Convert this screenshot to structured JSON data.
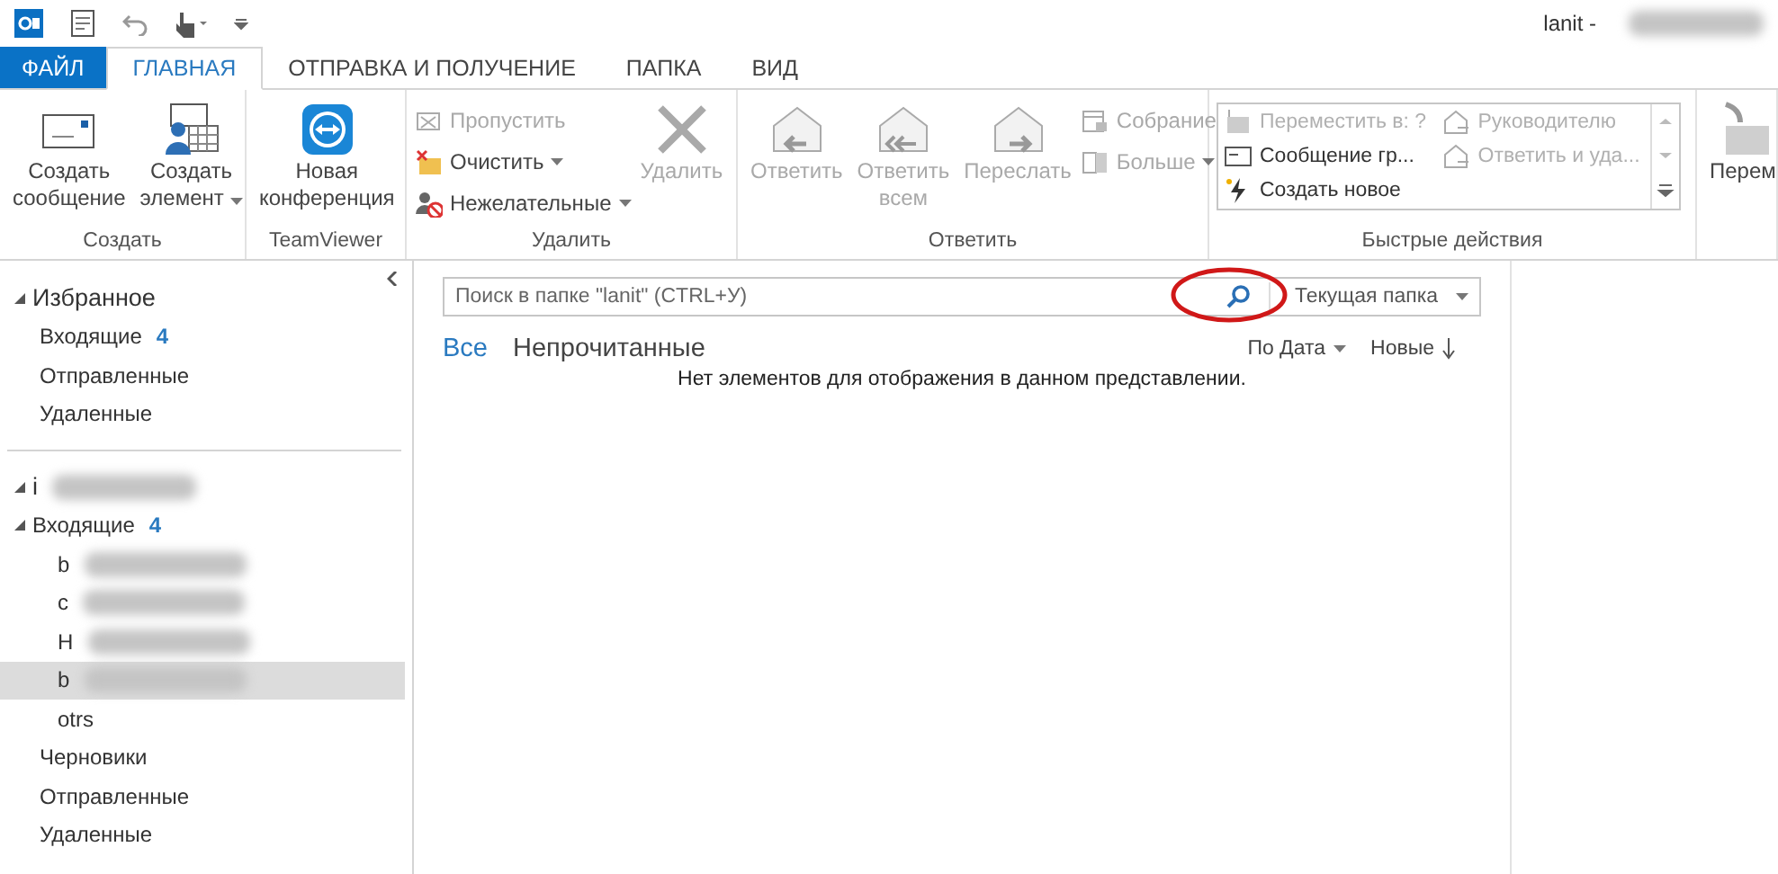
{
  "title_bar": {
    "title": "lanit -",
    "title_redacted": true
  },
  "tabs": [
    {
      "label": "ФАЙЛ",
      "kind": "file",
      "selected": false
    },
    {
      "label": "ГЛАВНАЯ",
      "kind": "tab",
      "selected": true
    },
    {
      "label": "ОТПРАВКА И ПОЛУЧЕНИЕ",
      "kind": "tab",
      "selected": false
    },
    {
      "label": "ПАПКА",
      "kind": "tab",
      "selected": false
    },
    {
      "label": "ВИД",
      "kind": "tab",
      "selected": false
    }
  ],
  "ribbon": {
    "groups": [
      {
        "label": "Создать",
        "items": [
          {
            "kind": "large",
            "label": "Создать\nсообщение",
            "disabled": false,
            "dropdown": false
          },
          {
            "kind": "large",
            "label": "Создать\nэлемент",
            "disabled": false,
            "dropdown": true
          }
        ]
      },
      {
        "label": "TeamViewer",
        "items": [
          {
            "kind": "large",
            "label": "Новая\nконференция",
            "disabled": false,
            "dropdown": false
          }
        ]
      },
      {
        "label": "Удалить",
        "items": [
          {
            "kind": "stack",
            "items": [
              {
                "label": "Пропустить",
                "disabled": true,
                "dropdown": false
              },
              {
                "label": "Очистить",
                "disabled": false,
                "dropdown": true
              },
              {
                "label": "Нежелательные",
                "disabled": false,
                "dropdown": true
              }
            ]
          },
          {
            "kind": "large",
            "label": "Удалить",
            "disabled": true,
            "dropdown": false
          }
        ]
      },
      {
        "label": "Ответить",
        "items": [
          {
            "kind": "large",
            "label": "Ответить",
            "disabled": true,
            "dropdown": false
          },
          {
            "kind": "large",
            "label": "Ответить\nвсем",
            "disabled": true,
            "dropdown": false
          },
          {
            "kind": "large",
            "label": "Переслать",
            "disabled": true,
            "dropdown": false
          },
          {
            "kind": "stack",
            "items": [
              {
                "label": "Собрание",
                "disabled": true,
                "dropdown": false
              },
              {
                "label": "Больше",
                "disabled": true,
                "dropdown": true
              }
            ]
          }
        ]
      },
      {
        "label": "Быстрые действия",
        "items": [
          {
            "kind": "gallery",
            "items": [
              {
                "label": "Переместить в: ?",
                "disabled": true
              },
              {
                "label": "Руководителю",
                "disabled": true
              },
              {
                "label": "Сообщение гр...",
                "disabled": false
              },
              {
                "label": "Ответить и уда...",
                "disabled": true
              },
              {
                "label": "Создать новое",
                "disabled": false
              }
            ]
          }
        ]
      },
      {
        "items": [
          {
            "kind": "large",
            "label": "Перем",
            "disabled": false,
            "dropdown": false
          }
        ]
      }
    ]
  },
  "folder_pane": {
    "favorites": {
      "label": "Избранное",
      "expanded": true,
      "items": [
        {
          "label": "Входящие",
          "count": "4",
          "selected": false
        },
        {
          "label": "Отправленные",
          "selected": false
        },
        {
          "label": "Удаленные",
          "selected": false
        }
      ]
    },
    "account": {
      "label": "i",
      "redacted": true,
      "expanded": true,
      "children": [
        {
          "label": "Входящие",
          "count": "4",
          "expanded": true,
          "selected": false,
          "children": [
            {
              "label": "b",
              "redacted": true,
              "selected": false
            },
            {
              "label": "c",
              "redacted": true,
              "selected": false
            },
            {
              "label": "H",
              "redacted": true,
              "selected": false
            },
            {
              "label": "b",
              "redacted": true,
              "selected": true
            },
            {
              "label": "otrs",
              "redacted": false,
              "selected": false
            }
          ]
        },
        {
          "label": "Черновики",
          "selected": false
        },
        {
          "label": "Отправленные",
          "selected": false
        },
        {
          "label": "Удаленные",
          "selected": false
        }
      ]
    }
  },
  "message_list": {
    "search": {
      "placeholder": "Поиск в папке \"lanit\" (CTRL+У)",
      "scope": "Текущая папка",
      "highlighted": true
    },
    "filters": [
      {
        "label": "Все",
        "selected": true
      },
      {
        "label": "Непрочитанные",
        "selected": false
      }
    ],
    "sort": {
      "by": "По Дата",
      "order": "Новые"
    },
    "empty_message": "Нет элементов для отображения в данном представлении."
  }
}
